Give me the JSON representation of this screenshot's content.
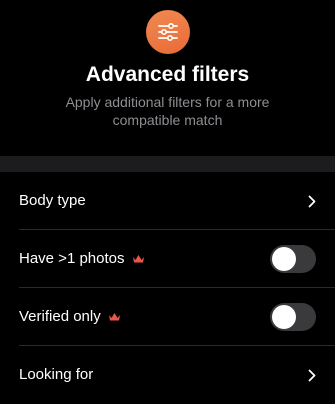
{
  "header": {
    "icon": "sliders-icon",
    "accent_color": "#ec7543",
    "title": "Advanced filters",
    "subtitle": "Apply additional filters for a more compatible match"
  },
  "filters": [
    {
      "label": "Body type",
      "control": "chevron"
    },
    {
      "label": "Have >1 photos",
      "control": "toggle",
      "premium": true,
      "enabled": false
    },
    {
      "label": "Verified only",
      "control": "toggle",
      "premium": true,
      "enabled": false
    },
    {
      "label": "Looking for",
      "control": "chevron"
    }
  ],
  "colors": {
    "premium_crown": "#e8584a",
    "toggle_off": "#3a3a3c"
  }
}
